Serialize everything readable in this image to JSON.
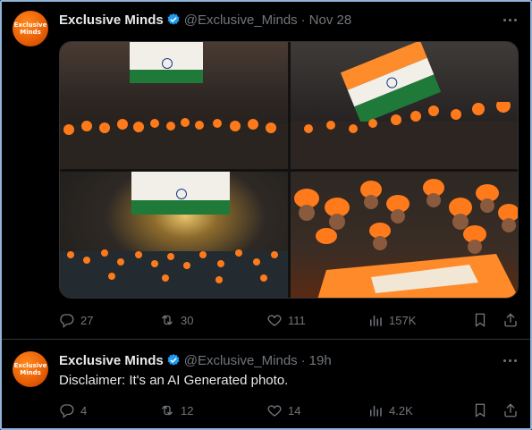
{
  "tweets": [
    {
      "author": {
        "name": "Exclusive Minds",
        "handle": "@Exclusive_Minds",
        "avatar_text": [
          "Exclusive",
          "Minds"
        ],
        "verified": true
      },
      "timestamp": "Nov 28",
      "text": "",
      "media": {
        "photo_count": 4,
        "description_icons": [
          "india-flag",
          "miners-helmets",
          "tunnel"
        ]
      },
      "stats": {
        "replies": "27",
        "retweets": "30",
        "likes": "111",
        "views": "157K"
      }
    },
    {
      "author": {
        "name": "Exclusive Minds",
        "handle": "@Exclusive_Minds",
        "avatar_text": [
          "Exclusive",
          "Minds"
        ],
        "verified": true
      },
      "timestamp": "19h",
      "text": "Disclaimer: It's an AI Generated photo.",
      "stats": {
        "replies": "4",
        "retweets": "12",
        "likes": "14",
        "views": "4.2K"
      }
    }
  ],
  "colors": {
    "background": "#000000",
    "text_primary": "#e7e9ea",
    "text_secondary": "#71767b",
    "verified_badge": "#1d9bf0",
    "divider": "#2f3336",
    "helmet_orange": "#ff7a1a",
    "avatar_orange": "#e85d04"
  },
  "icons": [
    "reply-icon",
    "retweet-icon",
    "like-icon",
    "views-icon",
    "bookmark-icon",
    "share-icon",
    "more-icon",
    "verified-icon"
  ]
}
